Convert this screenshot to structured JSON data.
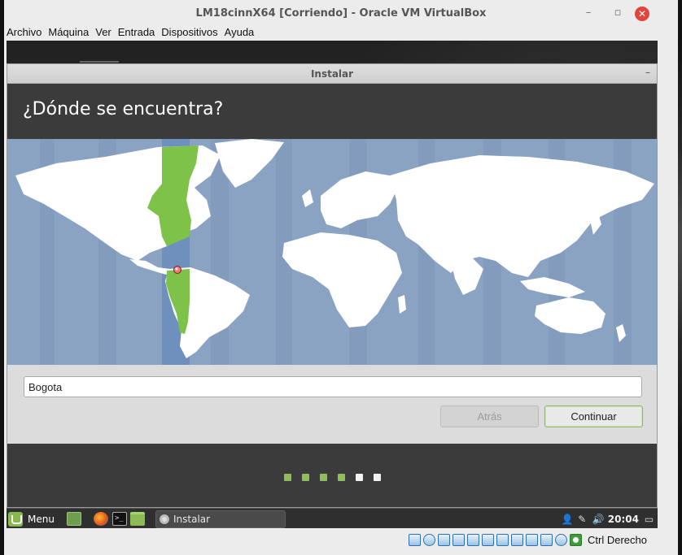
{
  "vbox": {
    "title": "LM18cinnX64 [Corriendo] - Oracle VM VirtualBox",
    "menu": [
      "Archivo",
      "Máquina",
      "Ver",
      "Entrada",
      "Dispositivos",
      "Ayuda"
    ],
    "host_key": "Ctrl Derecho",
    "status_icons": [
      "hard-disk-icon",
      "optical-drive-icon",
      "usb-icon",
      "shared-folders-icon",
      "network-icon",
      "display-icon",
      "video-capture-icon",
      "mouse-integration-icon",
      "keyboard-icon",
      "cpu-icon",
      "recording-icon",
      "host-key-icon"
    ]
  },
  "installer": {
    "window_title": "Instalar",
    "heading": "¿Dónde se encuentra?",
    "location_value": "Bogota",
    "back_label": "Atrás",
    "continue_label": "Continuar",
    "steps_total": 6,
    "steps_completed": 4,
    "selected_timezone_color": "#7fc24a",
    "selected_city_marker": "Bogota"
  },
  "taskbar": {
    "menu_label": "Menu",
    "launchers": [
      "show-desktop-icon",
      "firefox-icon",
      "terminal-icon",
      "files-icon"
    ],
    "task_label": "Instalar",
    "clock": "20:04",
    "tray_icons": [
      "user-icon",
      "network-icon",
      "volume-icon",
      "workspace-icon"
    ]
  },
  "colors": {
    "map_ocean": "#8aa3c3",
    "map_land": "#ffffff",
    "progress_done": "#8fbd5c",
    "progress_todo": "#f2f2f2",
    "header_bg": "#3b3b3b"
  }
}
